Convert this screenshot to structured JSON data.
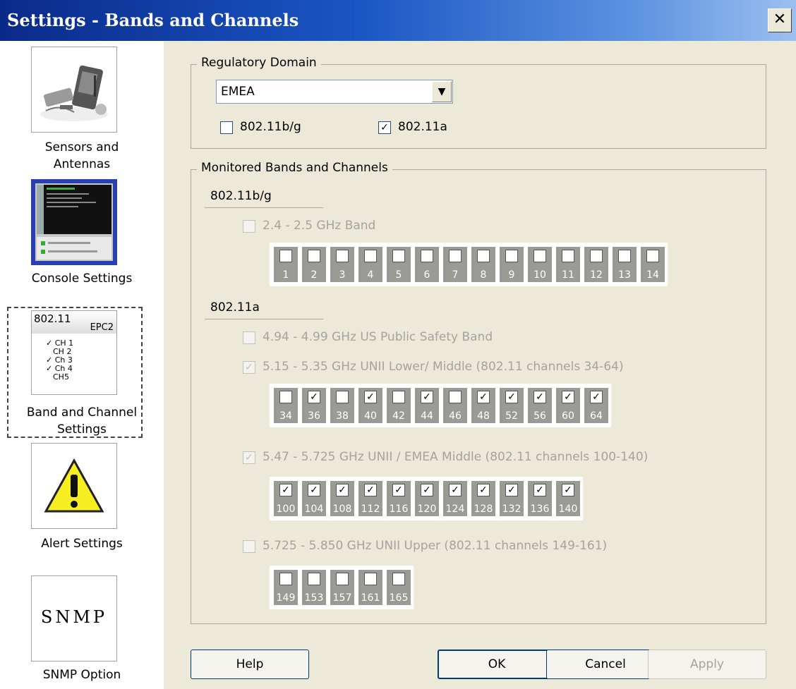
{
  "window": {
    "title": "Settings - Bands and Channels",
    "close": "✕"
  },
  "sidebar": {
    "items": [
      {
        "label1": "Sensors and",
        "label2": "Antennas"
      },
      {
        "label1": "Console Settings",
        "label2": ""
      },
      {
        "label1": "Band and Channel",
        "label2": "Settings",
        "icon_title": "802.11",
        "icon_sub": "EPC2",
        "icon_lines": [
          "✓ CH 1",
          "CH 2",
          "✓ Ch 3",
          "✓ Ch 4",
          "CH5"
        ]
      },
      {
        "label1": "Alert Settings",
        "label2": ""
      },
      {
        "label1": "SNMP Option",
        "label2": "",
        "icon_text": "SNMP"
      }
    ]
  },
  "regulatory": {
    "group_title": "Regulatory Domain",
    "domain": "EMEA",
    "arrow": "▼",
    "bg_label": "802.11b/g",
    "bg_checked": false,
    "a_label": "802.11a",
    "a_checked": true
  },
  "monitored": {
    "group_title": "Monitored Bands and Channels",
    "bg_section": "802.11b/g",
    "a_section": "802.11a",
    "bands": [
      {
        "label": "2.4 - 2.5 GHz Band",
        "checked": false
      },
      {
        "label": "4.94 - 4.99 GHz US Public Safety Band",
        "checked": false
      },
      {
        "label": "5.15 - 5.35 GHz UNII Lower/ Middle (802.11 channels 34-64)",
        "checked": true
      },
      {
        "label": "5.47 - 5.725 GHz UNII /  EMEA Middle (802.11 channels 100-140)",
        "checked": true
      },
      {
        "label": "5.725 - 5.850 GHz UNII Upper (802.11 channels 149-161)",
        "checked": false
      }
    ],
    "channels_24": [
      {
        "n": "1",
        "c": false
      },
      {
        "n": "2",
        "c": false
      },
      {
        "n": "3",
        "c": false
      },
      {
        "n": "4",
        "c": false
      },
      {
        "n": "5",
        "c": false
      },
      {
        "n": "6",
        "c": false
      },
      {
        "n": "7",
        "c": false
      },
      {
        "n": "8",
        "c": false
      },
      {
        "n": "9",
        "c": false
      },
      {
        "n": "10",
        "c": false
      },
      {
        "n": "11",
        "c": false
      },
      {
        "n": "12",
        "c": false
      },
      {
        "n": "13",
        "c": false
      },
      {
        "n": "14",
        "c": false
      }
    ],
    "channels_unii_lm": [
      {
        "n": "34",
        "c": false
      },
      {
        "n": "36",
        "c": true
      },
      {
        "n": "38",
        "c": false
      },
      {
        "n": "40",
        "c": true
      },
      {
        "n": "42",
        "c": false
      },
      {
        "n": "44",
        "c": true
      },
      {
        "n": "46",
        "c": false
      },
      {
        "n": "48",
        "c": true
      },
      {
        "n": "52",
        "c": true
      },
      {
        "n": "56",
        "c": true
      },
      {
        "n": "60",
        "c": true
      },
      {
        "n": "64",
        "c": true
      }
    ],
    "channels_emea": [
      {
        "n": "100",
        "c": true
      },
      {
        "n": "104",
        "c": true
      },
      {
        "n": "108",
        "c": true
      },
      {
        "n": "112",
        "c": true
      },
      {
        "n": "116",
        "c": true
      },
      {
        "n": "120",
        "c": true
      },
      {
        "n": "124",
        "c": true
      },
      {
        "n": "128",
        "c": true
      },
      {
        "n": "132",
        "c": true
      },
      {
        "n": "136",
        "c": true
      },
      {
        "n": "140",
        "c": true
      }
    ],
    "channels_upper": [
      {
        "n": "149",
        "c": false
      },
      {
        "n": "153",
        "c": false
      },
      {
        "n": "157",
        "c": false
      },
      {
        "n": "161",
        "c": false
      },
      {
        "n": "165",
        "c": false
      }
    ]
  },
  "buttons": {
    "help": "Help",
    "ok": "OK",
    "cancel": "Cancel",
    "apply": "Apply"
  }
}
